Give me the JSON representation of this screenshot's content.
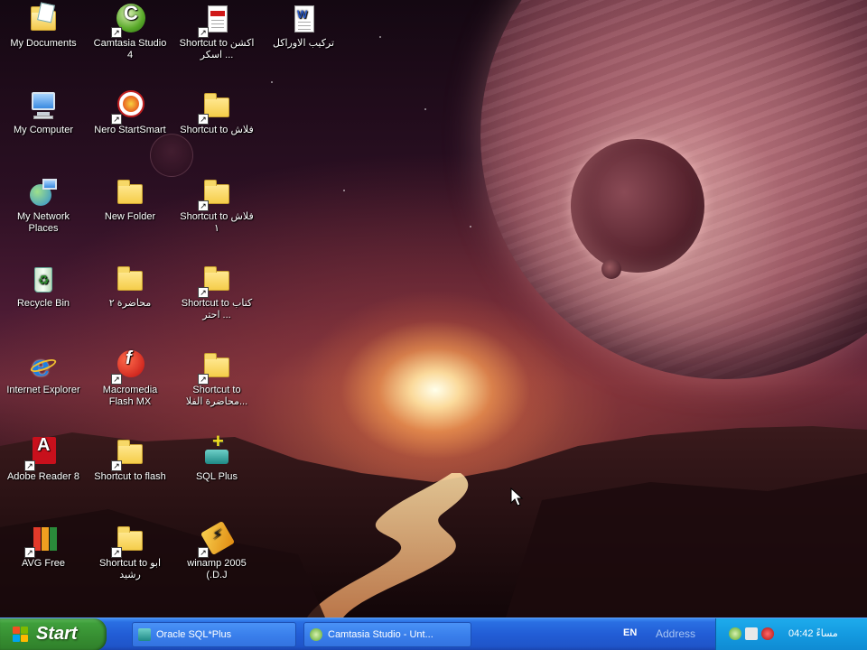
{
  "desktop": {
    "icons": [
      {
        "id": "my-documents",
        "label": "My Documents",
        "icon": "my-documents-icon"
      },
      {
        "id": "camtasia-studio",
        "label": "Camtasia Studio 4",
        "icon": "camtasia-icon"
      },
      {
        "id": "shortcut-pdf",
        "label": "Shortcut to اكشن اسكر ...",
        "icon": "pdf-icon"
      },
      {
        "id": "word-doc",
        "label": "تركيب الاوراكل",
        "icon": "word-document-icon"
      },
      {
        "id": "my-computer",
        "label": "My Computer",
        "icon": "my-computer-icon"
      },
      {
        "id": "nero",
        "label": "Nero StartSmart",
        "icon": "nero-icon"
      },
      {
        "id": "shortcut-flash",
        "label": "Shortcut to فلاش",
        "icon": "folder-shortcut-icon"
      },
      {
        "id": "my-network",
        "label": "My Network Places",
        "icon": "network-icon"
      },
      {
        "id": "new-folder",
        "label": "New Folder",
        "icon": "folder-icon"
      },
      {
        "id": "shortcut-flash1",
        "label": "Shortcut to فلاش ١",
        "icon": "folder-shortcut-icon"
      },
      {
        "id": "recycle-bin",
        "label": "Recycle Bin",
        "icon": "recycle-bin-icon"
      },
      {
        "id": "lecture2",
        "label": "محاضرة ٢",
        "icon": "folder-icon"
      },
      {
        "id": "shortcut-book",
        "label": "Shortcut to كتاب احتر ...",
        "icon": "folder-shortcut-icon"
      },
      {
        "id": "internet-explorer",
        "label": "Internet Explorer",
        "icon": "internet-explorer-icon"
      },
      {
        "id": "macromedia-flash",
        "label": "Macromedia Flash MX",
        "icon": "flash-icon"
      },
      {
        "id": "shortcut-lecture",
        "label": "Shortcut to محاضرة الفلا...",
        "icon": "folder-shortcut-icon"
      },
      {
        "id": "adobe-reader",
        "label": "Adobe Reader 8",
        "icon": "adobe-reader-icon"
      },
      {
        "id": "shortcut-to-flash",
        "label": "Shortcut to flash",
        "icon": "folder-shortcut-icon"
      },
      {
        "id": "sql-plus",
        "label": "SQL Plus",
        "icon": "sql-plus-icon"
      },
      {
        "id": "avg-free",
        "label": "AVG Free",
        "icon": "avg-icon"
      },
      {
        "id": "shortcut-abu",
        "label": "Shortcut to ابو رشيد",
        "icon": "folder-shortcut-icon"
      },
      {
        "id": "winamp",
        "label": "winamp 2005 (.D.J",
        "icon": "winamp-icon"
      }
    ]
  },
  "taskbar": {
    "start_label": "Start",
    "tasks": [
      {
        "label": "Oracle SQL*Plus",
        "icon": "sql-plus-icon"
      },
      {
        "label": "Camtasia Studio - Unt...",
        "icon": "camtasia-icon"
      }
    ],
    "language": "EN",
    "address_label": "Address",
    "clock": "04:42 مساءً"
  },
  "colors": {
    "taskbar_blue": "#225dd6",
    "start_green": "#368d31",
    "tray_blue": "#149ae0"
  }
}
